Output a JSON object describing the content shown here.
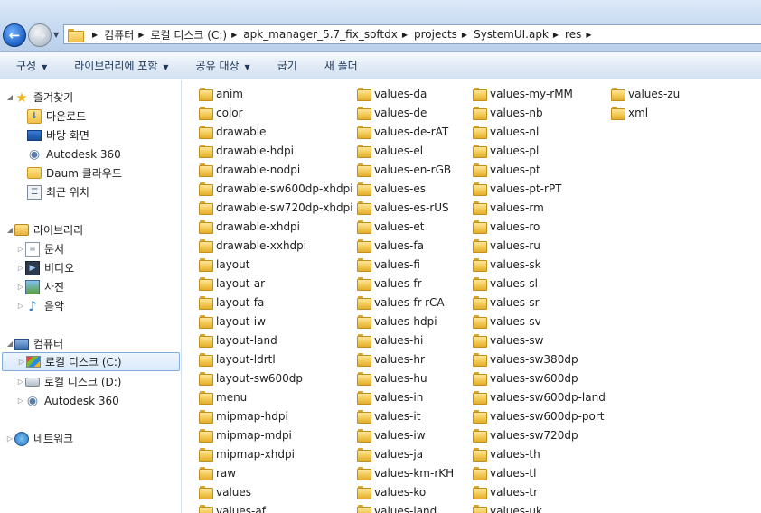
{
  "address": {
    "crumbs": [
      "컴퓨터",
      "로컬 디스크 (C:)",
      "apk_manager_5.7_fix_softdx",
      "projects",
      "SystemUI.apk",
      "res"
    ]
  },
  "toolbar": {
    "organize": "구성",
    "include_library": "라이브러리에 포함",
    "share_with": "공유 대상",
    "burn": "굽기",
    "new_folder": "새 폴더"
  },
  "nav": {
    "favorites": "즐겨찾기",
    "downloads": "다운로드",
    "desktop": "바탕 화면",
    "autodesk360_fav": "Autodesk 360",
    "daum_cloud": "Daum 클라우드",
    "recent_places": "최근 위치",
    "libraries": "라이브러리",
    "documents": "문서",
    "videos": "비디오",
    "pictures": "사진",
    "music": "음악",
    "computer": "컴퓨터",
    "drive_c": "로컬 디스크 (C:)",
    "drive_d": "로컬 디스크 (D:)",
    "autodesk360_pc": "Autodesk 360",
    "network": "네트워크"
  },
  "files": {
    "col1": [
      "anim",
      "color",
      "drawable",
      "drawable-hdpi",
      "drawable-nodpi",
      "drawable-sw600dp-xhdpi",
      "drawable-sw720dp-xhdpi",
      "drawable-xhdpi",
      "drawable-xxhdpi",
      "layout",
      "layout-ar",
      "layout-fa",
      "layout-iw",
      "layout-land",
      "layout-ldrtl",
      "layout-sw600dp",
      "menu",
      "mipmap-hdpi",
      "mipmap-mdpi",
      "mipmap-xhdpi",
      "raw",
      "values",
      "values-af"
    ],
    "col2": [
      "values-da",
      "values-de",
      "values-de-rAT",
      "values-el",
      "values-en-rGB",
      "values-es",
      "values-es-rUS",
      "values-et",
      "values-fa",
      "values-fi",
      "values-fr",
      "values-fr-rCA",
      "values-hdpi",
      "values-hi",
      "values-hr",
      "values-hu",
      "values-in",
      "values-it",
      "values-iw",
      "values-ja",
      "values-km-rKH",
      "values-ko",
      "values-land"
    ],
    "col3": [
      "values-my-rMM",
      "values-nb",
      "values-nl",
      "values-pl",
      "values-pt",
      "values-pt-rPT",
      "values-rm",
      "values-ro",
      "values-ru",
      "values-sk",
      "values-sl",
      "values-sr",
      "values-sv",
      "values-sw",
      "values-sw380dp",
      "values-sw600dp",
      "values-sw600dp-land",
      "values-sw600dp-port",
      "values-sw720dp",
      "values-th",
      "values-tl",
      "values-tr",
      "values-uk"
    ],
    "col4": [
      "values-zu",
      "xml"
    ]
  }
}
